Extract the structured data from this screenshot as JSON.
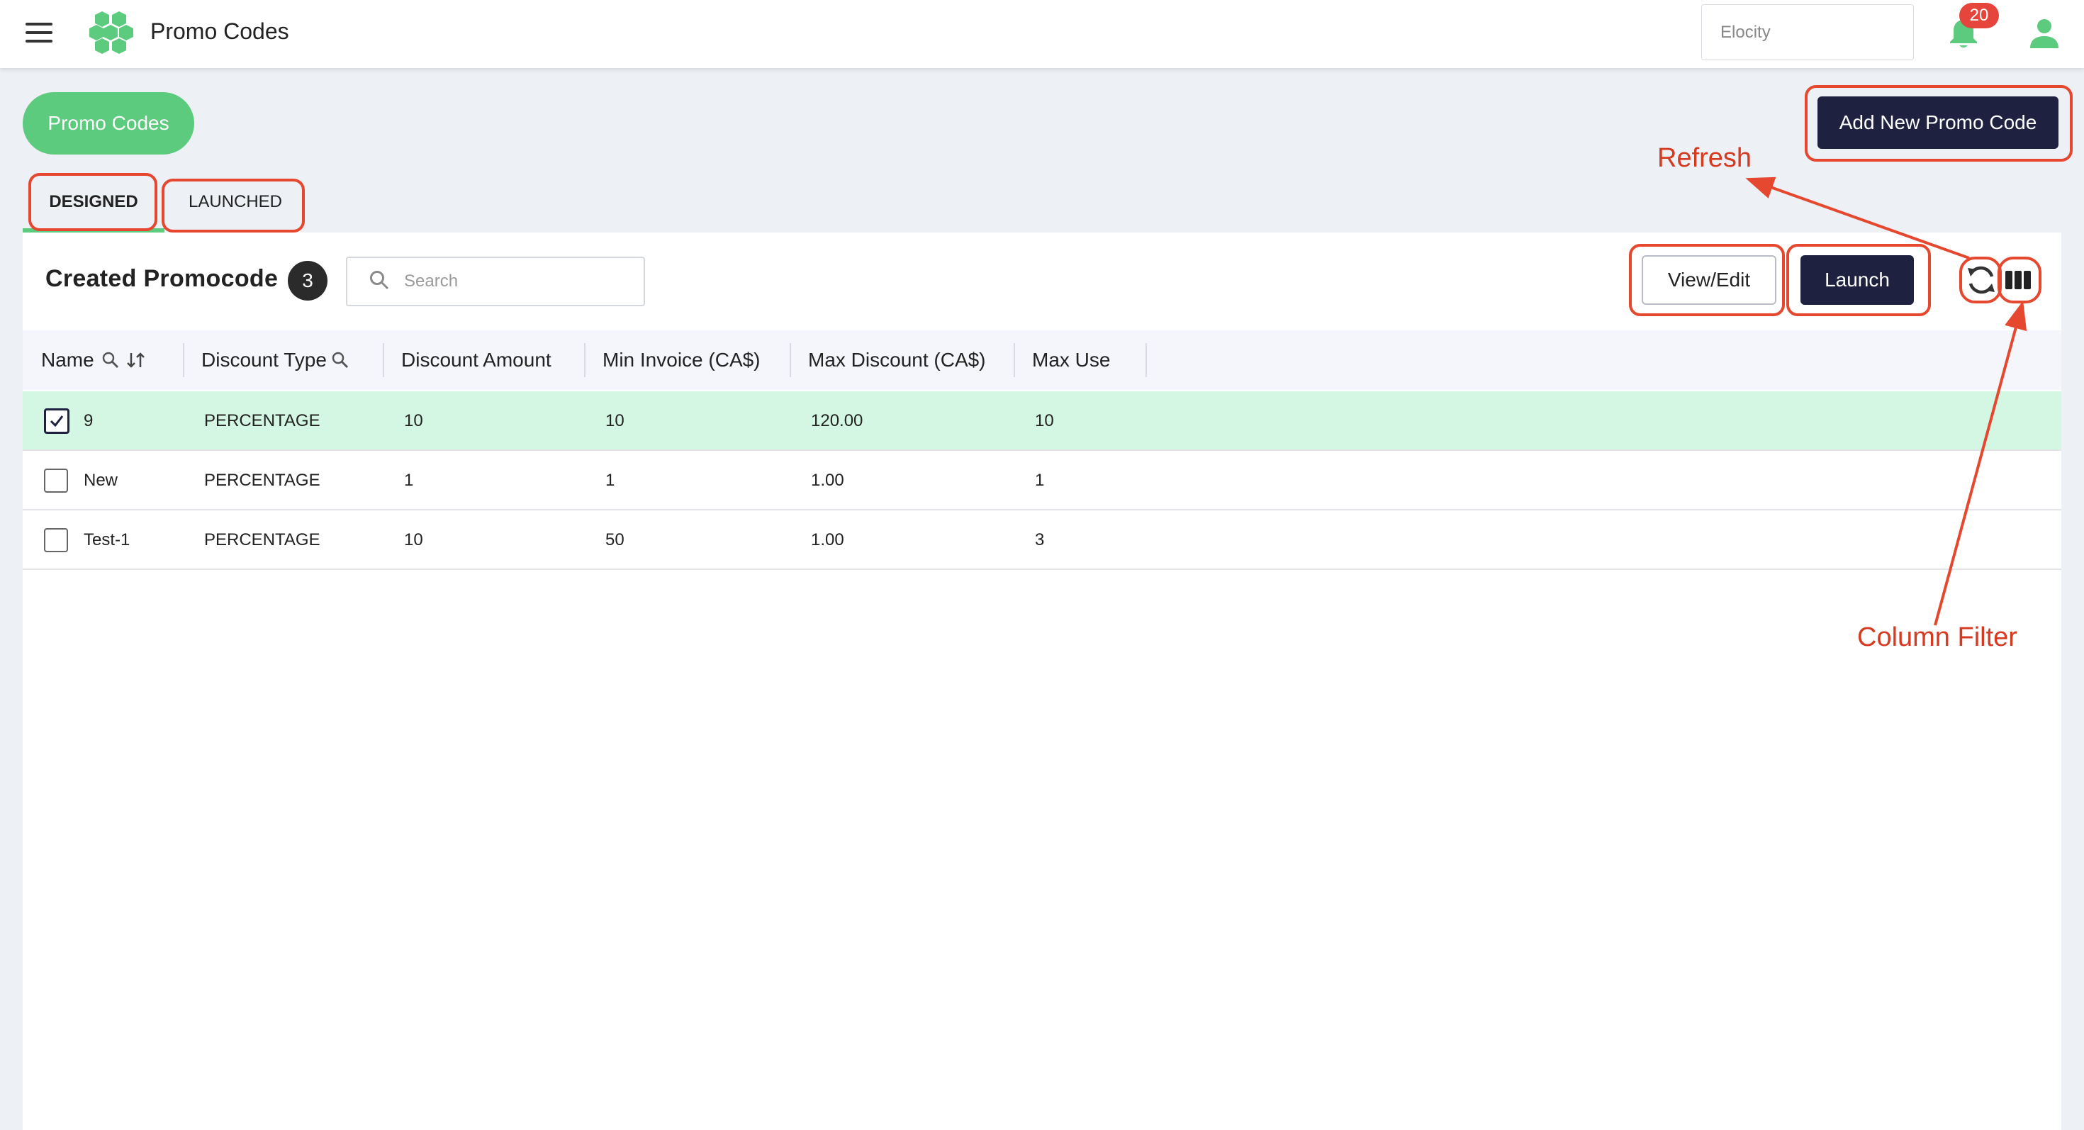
{
  "header": {
    "app_title": "Promo Codes",
    "org_placeholder": "Elocity",
    "notification_count": "20",
    "accent_color": "#5ccb7d",
    "icons": [
      "menu-icon",
      "logo-icon",
      "bell-icon",
      "user-icon"
    ]
  },
  "page": {
    "pill_label": "Promo Codes",
    "add_button_label": "Add New Promo Code",
    "tabs": [
      {
        "label": "DESIGNED",
        "active": true
      },
      {
        "label": "LAUNCHED",
        "active": false
      }
    ]
  },
  "card": {
    "title": "Created Promocode",
    "count": "3",
    "search_placeholder": "Search",
    "view_edit_label": "View/Edit",
    "launch_label": "Launch",
    "icons": [
      "search-icon",
      "refresh-icon",
      "column-filter-icon"
    ]
  },
  "table": {
    "columns": [
      "Name",
      "Discount Type",
      "Discount Amount",
      "Min Invoice (CA$)",
      "Max Discount (CA$)",
      "Max Use"
    ],
    "rows": [
      {
        "checked": true,
        "name": "9",
        "type": "PERCENTAGE",
        "amount": "10",
        "min_invoice": "10",
        "max_discount": "120.00",
        "max_use": "10"
      },
      {
        "checked": false,
        "name": "New",
        "type": "PERCENTAGE",
        "amount": "1",
        "min_invoice": "1",
        "max_discount": "1.00",
        "max_use": "1"
      },
      {
        "checked": false,
        "name": "Test-1",
        "type": "PERCENTAGE",
        "amount": "10",
        "min_invoice": "50",
        "max_discount": "1.00",
        "max_use": "3"
      }
    ]
  },
  "annotations": {
    "refresh_label": "Refresh",
    "column_filter_label": "Column Filter",
    "color": "#e5482e"
  }
}
